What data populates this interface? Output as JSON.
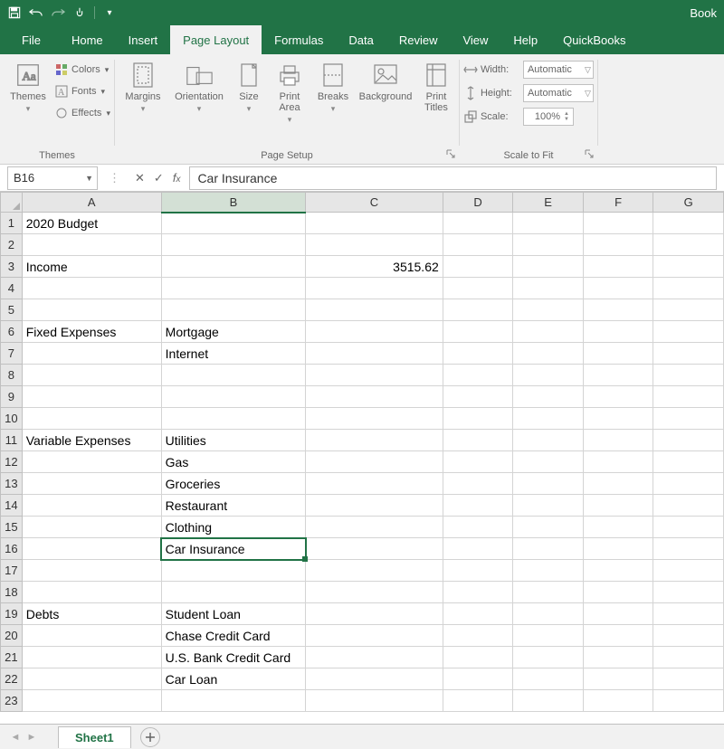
{
  "titlebar": {
    "doc_name": "Book"
  },
  "tabs": {
    "file": "File",
    "home": "Home",
    "insert": "Insert",
    "page_layout": "Page Layout",
    "formulas": "Formulas",
    "data": "Data",
    "review": "Review",
    "view": "View",
    "help": "Help",
    "quickbooks": "QuickBooks"
  },
  "ribbon": {
    "themes": {
      "group_label": "Themes",
      "themes_btn": "Themes",
      "colors": "Colors",
      "fonts": "Fonts",
      "effects": "Effects"
    },
    "page_setup": {
      "group_label": "Page Setup",
      "margins": "Margins",
      "orientation": "Orientation",
      "size": "Size",
      "print_area": "Print\nArea",
      "breaks": "Breaks",
      "background": "Background",
      "print_titles": "Print\nTitles"
    },
    "scale": {
      "group_label": "Scale to Fit",
      "width_label": "Width:",
      "width_value": "Automatic",
      "height_label": "Height:",
      "height_value": "Automatic",
      "scale_label": "Scale:",
      "scale_value": "100%"
    }
  },
  "namebar": {
    "cell_ref": "B16",
    "formula_value": "Car Insurance"
  },
  "columns": [
    "A",
    "B",
    "C",
    "D",
    "E",
    "F",
    "G"
  ],
  "rows": [
    {
      "n": 1,
      "A": "2020 Budget"
    },
    {
      "n": 2
    },
    {
      "n": 3,
      "A": "Income",
      "C": "3515.62"
    },
    {
      "n": 4
    },
    {
      "n": 5
    },
    {
      "n": 6,
      "A": "Fixed Expenses",
      "B": "Mortgage"
    },
    {
      "n": 7,
      "B": "Internet"
    },
    {
      "n": 8
    },
    {
      "n": 9
    },
    {
      "n": 10
    },
    {
      "n": 11,
      "A": "Variable Expenses",
      "B": "Utilities"
    },
    {
      "n": 12,
      "B": "Gas"
    },
    {
      "n": 13,
      "B": "Groceries"
    },
    {
      "n": 14,
      "B": "Restaurant"
    },
    {
      "n": 15,
      "B": "Clothing"
    },
    {
      "n": 16,
      "B": "Car Insurance"
    },
    {
      "n": 17
    },
    {
      "n": 18
    },
    {
      "n": 19,
      "A": "Debts",
      "B": "Student Loan"
    },
    {
      "n": 20,
      "B": "Chase Credit Card"
    },
    {
      "n": 21,
      "B": "U.S. Bank Credit Card"
    },
    {
      "n": 22,
      "B": "Car Loan"
    },
    {
      "n": 23
    }
  ],
  "selected_cell": "B16",
  "sheets": {
    "active": "Sheet1"
  }
}
